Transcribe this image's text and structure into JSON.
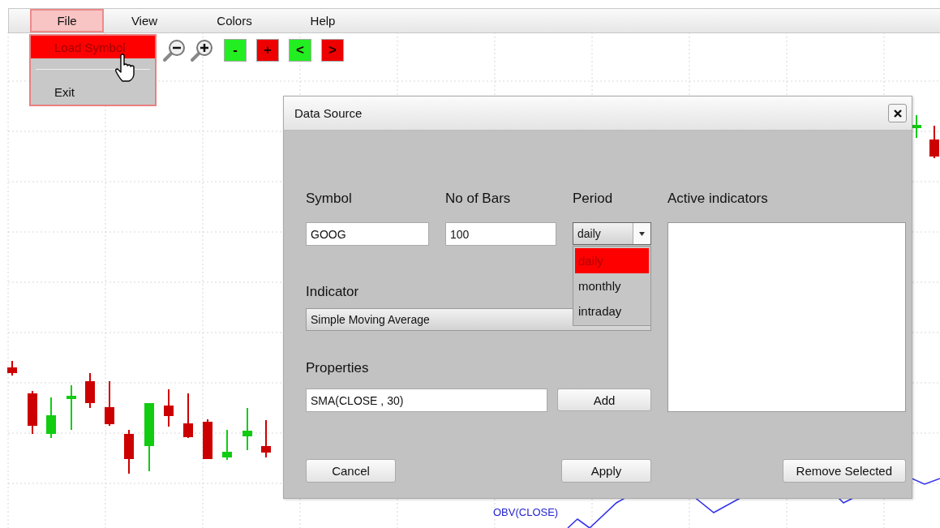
{
  "menubar": [
    {
      "label": "File",
      "selected": true
    },
    {
      "label": "View",
      "selected": false
    },
    {
      "label": "Colors",
      "selected": false
    },
    {
      "label": "Help",
      "selected": false
    }
  ],
  "file_menu": [
    {
      "kind": "item",
      "label": "Load Symbol",
      "selected": true
    },
    {
      "kind": "separator"
    },
    {
      "kind": "item",
      "label": "Exit",
      "selected": false
    }
  ],
  "toolbar": [
    {
      "kind": "zoom-out"
    },
    {
      "kind": "zoom-in"
    },
    {
      "kind": "text",
      "label": "-",
      "color": "#22ee22"
    },
    {
      "kind": "text",
      "label": "+",
      "color": "#ee0000"
    },
    {
      "kind": "text",
      "label": "<",
      "color": "#22ee22"
    },
    {
      "kind": "text",
      "label": ">",
      "color": "#ee0000"
    }
  ],
  "chart": {
    "indicator_label": "OBV(CLOSE)"
  },
  "dialog": {
    "title": "Data Source",
    "symbol": {
      "label": "Symbol",
      "value": "GOOG"
    },
    "bars": {
      "label": "No of Bars",
      "value": "100"
    },
    "period": {
      "label": "Period",
      "value": "daily",
      "expanded": true,
      "options": [
        {
          "label": "daily",
          "selected": true
        },
        {
          "label": "monthly",
          "selected": false
        },
        {
          "label": "intraday",
          "selected": false
        }
      ]
    },
    "active_indicators": {
      "label": "Active indicators"
    },
    "indicator": {
      "label": "Indicator",
      "value": "Simple Moving Average"
    },
    "properties": {
      "label": "Properties",
      "value": "SMA(CLOSE , 30)"
    },
    "add_button": "Add",
    "buttons": [
      "Cancel",
      "Apply",
      "Remove Selected"
    ]
  }
}
